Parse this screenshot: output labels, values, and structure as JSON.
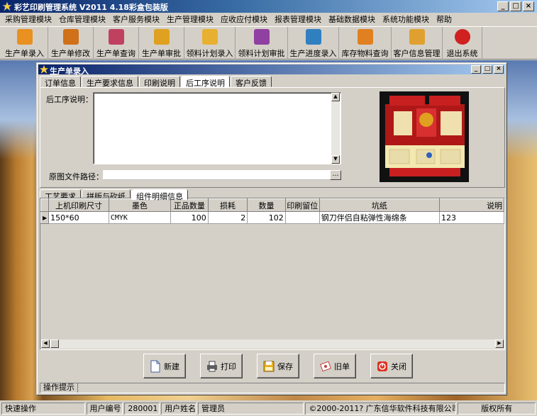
{
  "app": {
    "title": "彩艺印刷管理系统  V2011 4.18彩盒包装版"
  },
  "menu": [
    "采购管理模块",
    "仓库管理模块",
    "客户服务模块",
    "生产管理模块",
    "应收应付模块",
    "报表管理模块",
    "基础数据模块",
    "系统功能模块",
    "帮助"
  ],
  "toolbar": [
    {
      "label": "生产单录入",
      "icon": "box-add-icon",
      "color": "#e89020"
    },
    {
      "label": "生产单修改",
      "icon": "box-edit-icon",
      "color": "#d07018"
    },
    {
      "label": "生产单查询",
      "icon": "search-box-icon",
      "color": "#c04060"
    },
    {
      "label": "生产单审批",
      "icon": "approve-icon",
      "color": "#e0a020"
    },
    {
      "label": "领料计划录入",
      "icon": "material-plan-icon",
      "color": "#e8b030"
    },
    {
      "label": "领料计划审批",
      "icon": "material-approve-icon",
      "color": "#9040a0"
    },
    {
      "label": "生产进度录入",
      "icon": "progress-chart-icon",
      "color": "#3080c0"
    },
    {
      "label": "库存物料查询",
      "icon": "stock-search-icon",
      "color": "#e08020"
    },
    {
      "label": "客户信息管理",
      "icon": "customer-icon",
      "color": "#e0a030"
    },
    {
      "label": "退出系统",
      "icon": "exit-icon",
      "color": "#d02020"
    }
  ],
  "child": {
    "title": "生产单录入",
    "tabs": [
      "订单信息",
      "生产要求信息",
      "印刷说明",
      "后工序说明",
      "客户反馈"
    ],
    "active_tab": 3,
    "postprocess_label": "后工序说明：",
    "postprocess_value": "",
    "path_label": "原图文件路径：",
    "path_value": "",
    "path_button": "…",
    "subtabs": [
      "工艺要求",
      "拼版与砍纸",
      "组件明细信息"
    ],
    "active_subtab": 2,
    "grid": {
      "columns": [
        "上机印刷尺寸",
        "墨色",
        "正品数量",
        "损耗",
        "数量",
        "印刷留位",
        "坑纸",
        "说明"
      ],
      "rows": [
        {
          "size": "150*60",
          "ink": "CMYK",
          "good_qty": "100",
          "loss": "2",
          "qty": "102",
          "print_margin": "",
          "paper": "钢刀伴侣自粘弹性海绵条",
          "note": "123"
        }
      ]
    },
    "buttons": [
      {
        "label": "新建",
        "icon": "new-doc-icon"
      },
      {
        "label": "打印",
        "icon": "printer-icon"
      },
      {
        "label": "保存",
        "icon": "save-disk-icon"
      },
      {
        "label": "旧单",
        "icon": "old-order-icon"
      },
      {
        "label": "关闭",
        "icon": "close-icon"
      }
    ],
    "hint_label": "操作提示"
  },
  "status": {
    "quick": "快速操作",
    "user_no_label": "用户编号",
    "user_no": "280001",
    "user_name_label": "用户姓名",
    "user_name": "管理员",
    "copyright": "©2000-2011?    广东信华软件科技有限公司",
    "rights": "版权所有"
  }
}
